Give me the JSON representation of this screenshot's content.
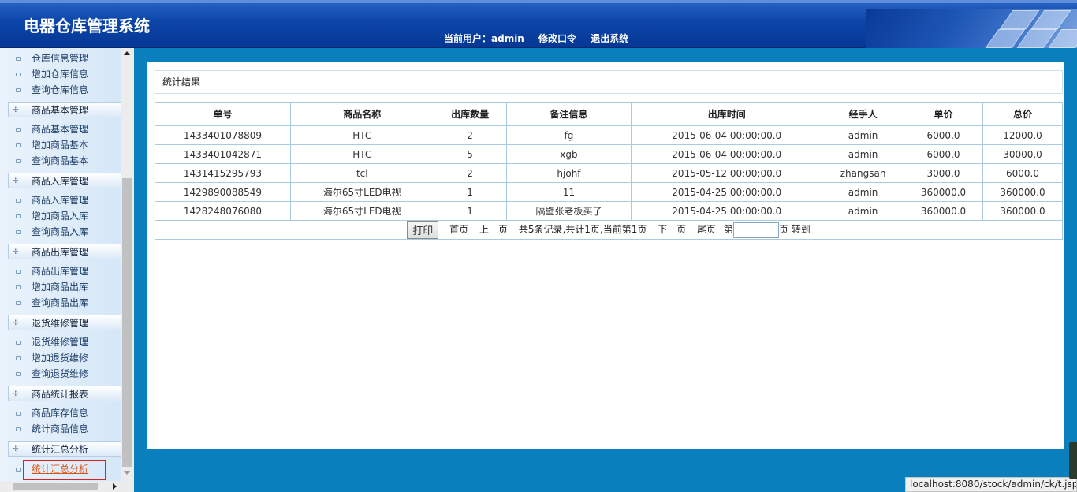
{
  "header": {
    "title": "电器仓库管理系统",
    "current_user_label": "当前用户：admin",
    "change_password": "修改口令",
    "logout": "退出系统"
  },
  "sidebar": {
    "items": [
      {
        "type": "item",
        "label": "仓库信息管理"
      },
      {
        "type": "item",
        "label": "增加仓库信息"
      },
      {
        "type": "item",
        "label": "查询仓库信息"
      },
      {
        "type": "group",
        "label": "商品基本管理"
      },
      {
        "type": "item",
        "label": "商品基本管理"
      },
      {
        "type": "item",
        "label": "增加商品基本"
      },
      {
        "type": "item",
        "label": "查询商品基本"
      },
      {
        "type": "group",
        "label": "商品入库管理"
      },
      {
        "type": "item",
        "label": "商品入库管理"
      },
      {
        "type": "item",
        "label": "增加商品入库"
      },
      {
        "type": "item",
        "label": "查询商品入库"
      },
      {
        "type": "group",
        "label": "商品出库管理"
      },
      {
        "type": "item",
        "label": "商品出库管理"
      },
      {
        "type": "item",
        "label": "增加商品出库"
      },
      {
        "type": "item",
        "label": "查询商品出库"
      },
      {
        "type": "group",
        "label": "退货维修管理"
      },
      {
        "type": "item",
        "label": "退货维修管理"
      },
      {
        "type": "item",
        "label": "增加退货维修"
      },
      {
        "type": "item",
        "label": "查询退货维修"
      },
      {
        "type": "group",
        "label": "商品统计报表"
      },
      {
        "type": "item",
        "label": "商品库存信息"
      },
      {
        "type": "item",
        "label": "统计商品信息"
      },
      {
        "type": "group",
        "label": "统计汇总分析"
      },
      {
        "type": "item",
        "label": "统计汇总分析",
        "active": true
      }
    ]
  },
  "main": {
    "section_title": "统计结果",
    "table": {
      "headers": [
        "单号",
        "商品名称",
        "出库数量",
        "备注信息",
        "出库时间",
        "经手人",
        "单价",
        "总价"
      ],
      "rows": [
        [
          "1433401078809",
          "HTC",
          "2",
          "fg",
          "2015-06-04 00:00:00.0",
          "admin",
          "6000.0",
          "12000.0"
        ],
        [
          "1433401042871",
          "HTC",
          "5",
          "xgb",
          "2015-06-04 00:00:00.0",
          "admin",
          "6000.0",
          "30000.0"
        ],
        [
          "1431415295793",
          "tcl",
          "2",
          "hjohf",
          "2015-05-12 00:00:00.0",
          "zhangsan",
          "3000.0",
          "6000.0"
        ],
        [
          "1429890088549",
          "海尔65寸LED电视",
          "1",
          "11",
          "2015-04-25 00:00:00.0",
          "admin",
          "360000.0",
          "360000.0"
        ],
        [
          "1428248076080",
          "海尔65寸LED电视",
          "1",
          "隔壁张老板买了",
          "2015-04-25 00:00:00.0",
          "admin",
          "360000.0",
          "360000.0"
        ]
      ]
    },
    "pager": {
      "print": "打印",
      "first": "首页",
      "prev": "上一页",
      "summary": "共5条记录,共计1页,当前第1页",
      "next": "下一页",
      "last": "尾页",
      "page_prefix": "第",
      "page_input_value": "",
      "page_suffix": "页 转到"
    }
  },
  "status_bar": {
    "url": "localhost:8080/stock/admin/ck/t.jsp"
  },
  "colors": {
    "header_blue": "#0c45a8",
    "main_bg": "#0a7fbd",
    "active_link": "#e05010",
    "highlight_outline": "#e02020"
  }
}
